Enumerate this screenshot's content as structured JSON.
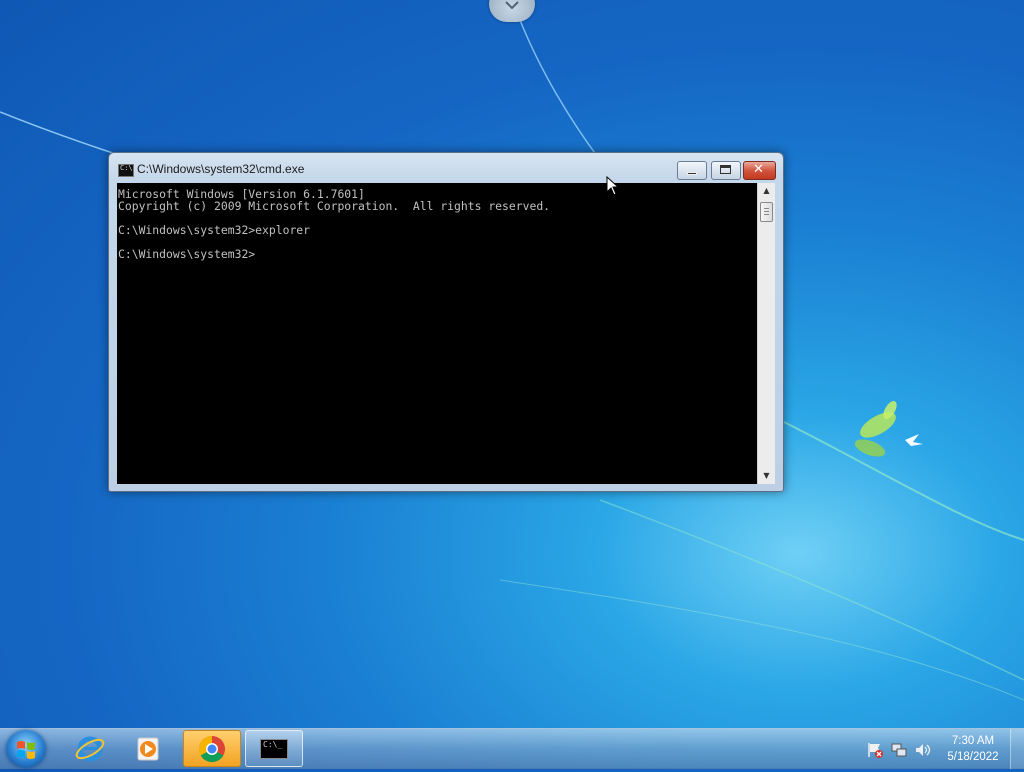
{
  "window": {
    "title": "C:\\Windows\\system32\\cmd.exe",
    "icon_text": "C:\\",
    "console_lines": [
      "Microsoft Windows [Version 6.1.7601]",
      "Copyright (c) 2009 Microsoft Corporation.  All rights reserved.",
      "",
      "C:\\Windows\\system32>explorer",
      "",
      "C:\\Windows\\system32>"
    ]
  },
  "taskbar": {
    "items": [
      {
        "name": "internet-explorer",
        "icon": "ie-icon"
      },
      {
        "name": "media-player",
        "icon": "media-player-icon"
      },
      {
        "name": "chrome",
        "icon": "chrome-icon"
      },
      {
        "name": "cmd",
        "icon": "cmd-icon",
        "icon_text": "C:\\_"
      }
    ],
    "clock_time": "7:30 AM",
    "clock_date": "5/18/2022"
  },
  "colors": {
    "console_bg": "#000000",
    "console_fg": "#c0c0c0",
    "close_button": "#c2391f"
  }
}
